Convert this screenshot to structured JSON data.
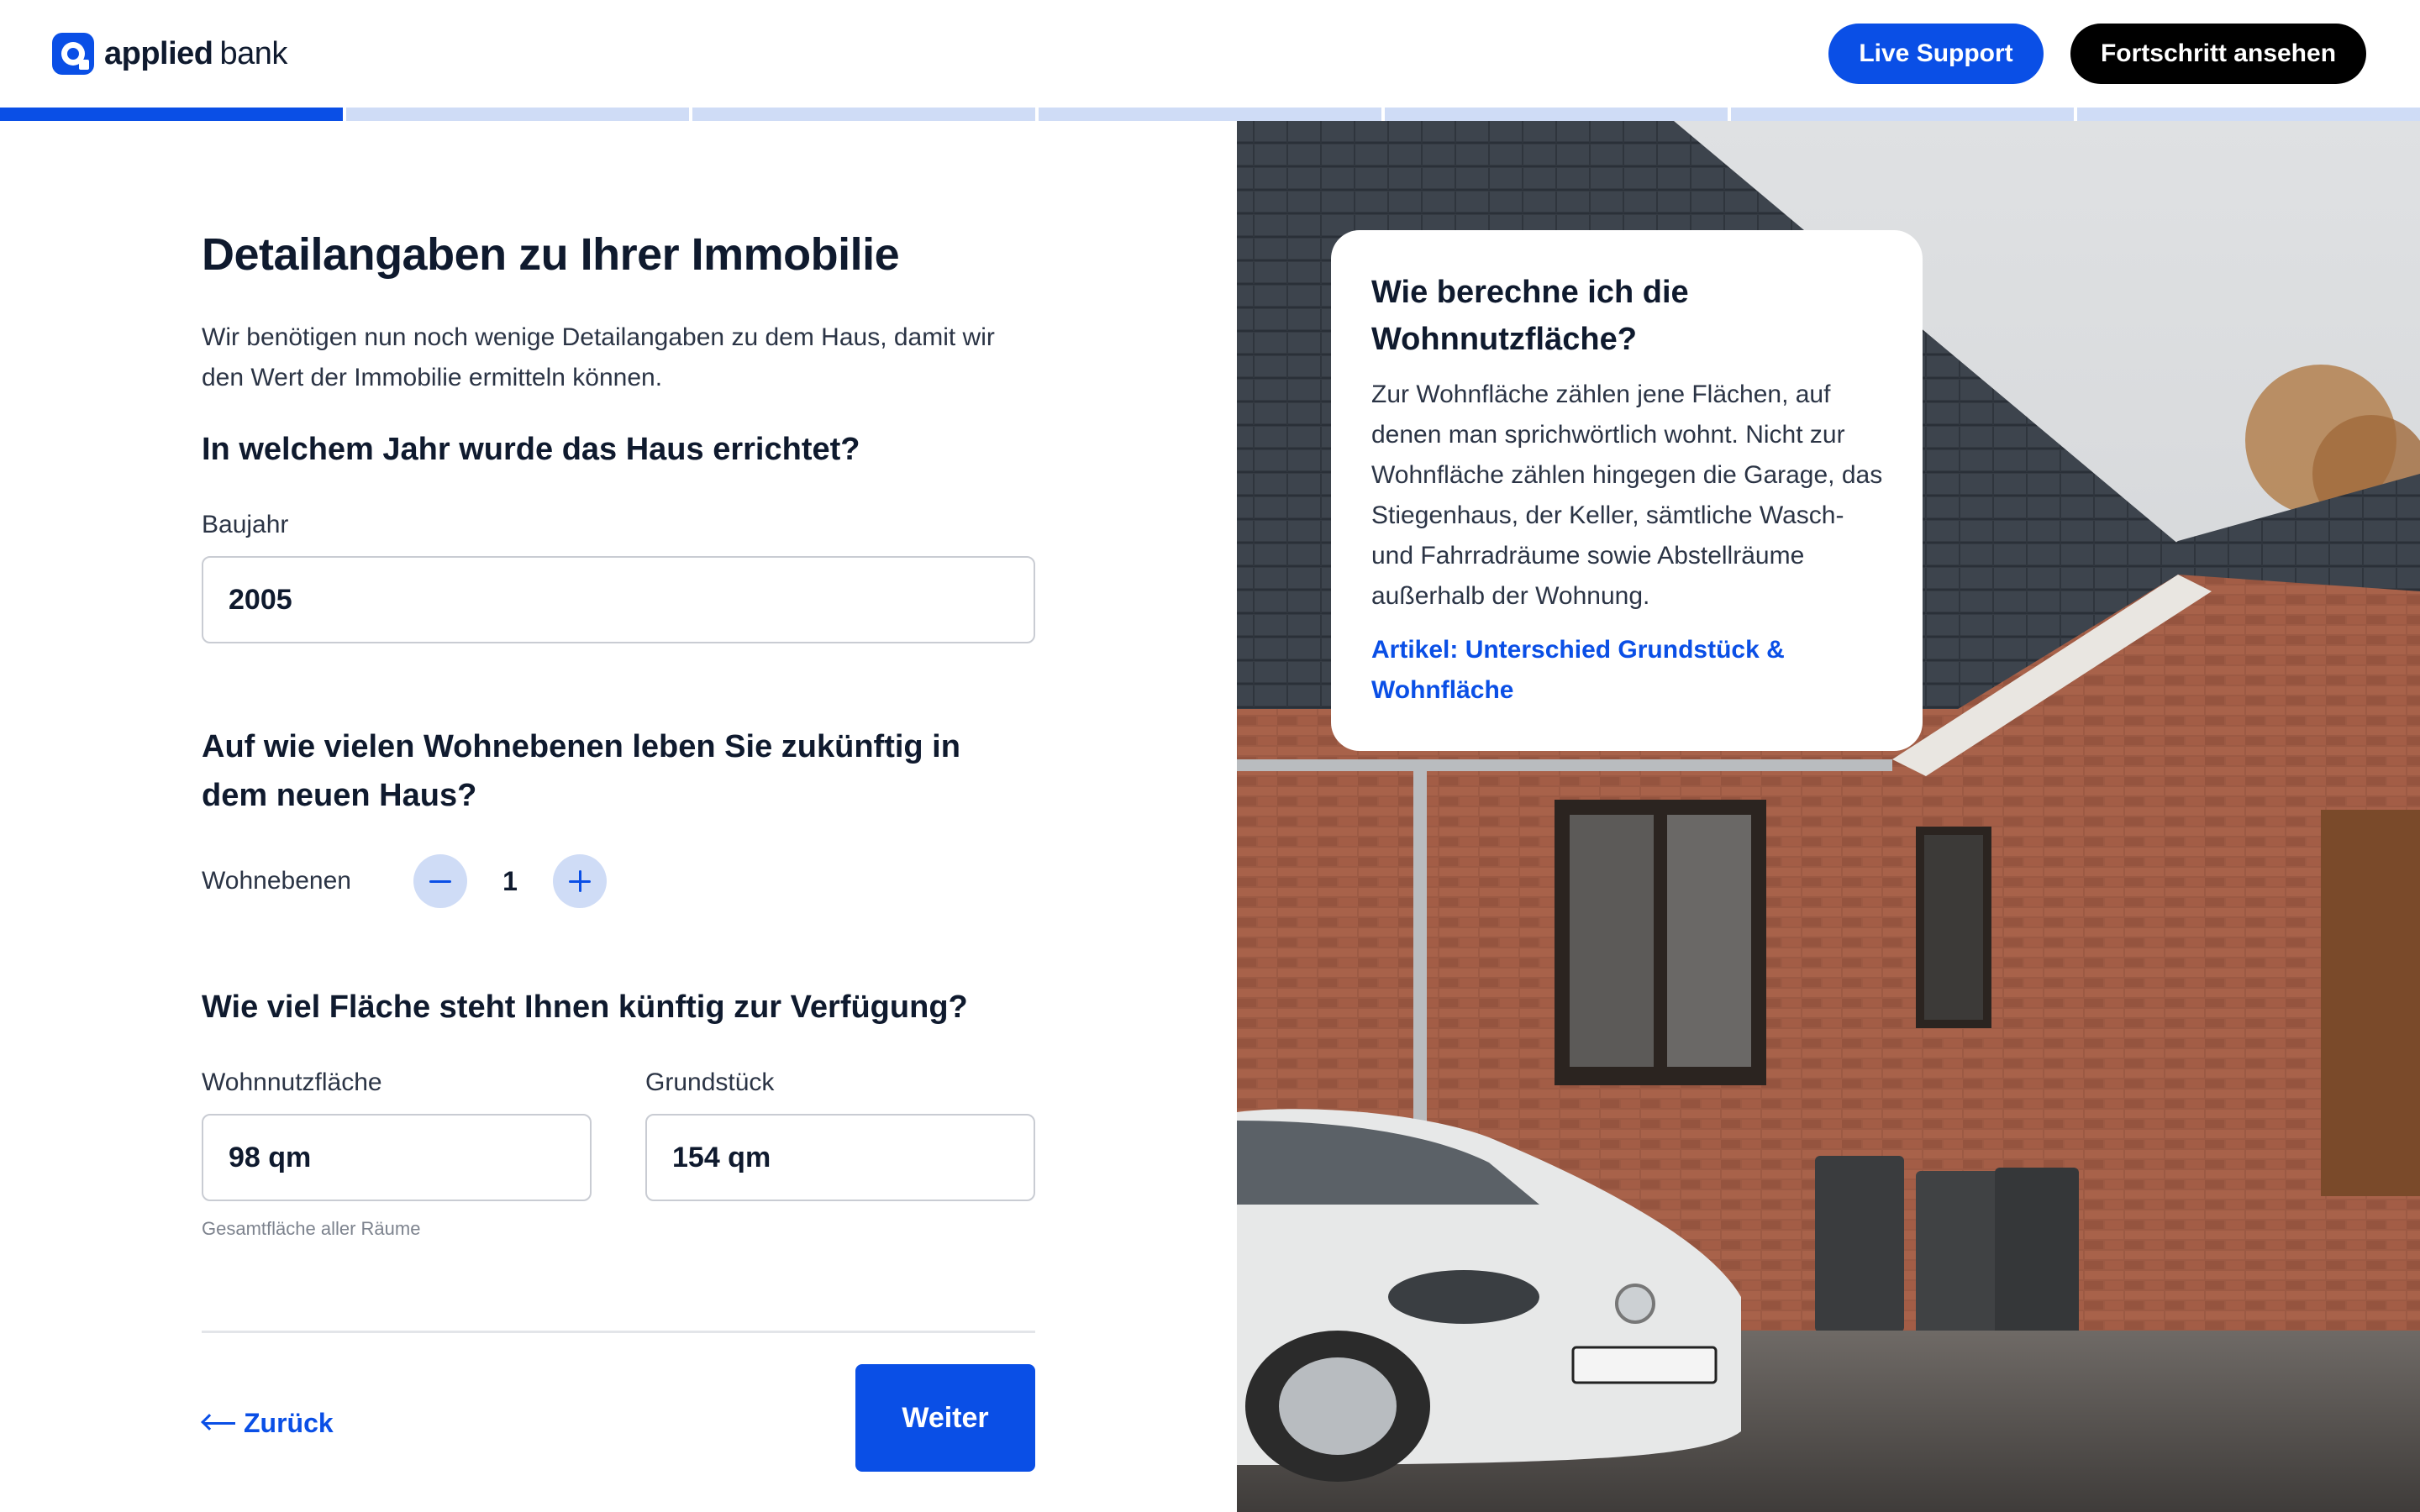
{
  "header": {
    "logo_bold": "applied",
    "logo_regular": "bank",
    "live_support": "Live Support",
    "progress_button": "Fortschritt ansehen"
  },
  "progress": {
    "steps_total": 7,
    "steps_done": 1
  },
  "form": {
    "title": "Detailangaben zu Ihrer Immobilie",
    "intro": "Wir benötigen nun noch wenige Detailangaben zu dem Haus, damit wir den Wert der Immobilie ermitteln können.",
    "q_year": "In welchem Jahr wurde das Haus errichtet?",
    "year_label": "Baujahr",
    "year_value": "2005",
    "q_levels": "Auf wie vielen Wohnebenen leben Sie zukünftig in dem neuen Haus?",
    "levels_label": "Wohnebenen",
    "levels_value": "1",
    "q_area": "Wie viel Fläche steht Ihnen künftig zur Verfügung?",
    "living_label": "Wohnnutzfläche",
    "living_value": "98 qm",
    "living_hint": "Gesamtfläche aller Räume",
    "plot_label": "Grundstück",
    "plot_value": "154 qm",
    "back_label": "Zurück",
    "next_label": "Weiter"
  },
  "info_card": {
    "title": "Wie berechne ich die Wohnnutzfläche?",
    "body": "Zur Wohnfläche zählen jene Flächen, auf denen man sprichwörtlich wohnt.  Nicht zur Wohnfläche zählen hingegen die Garage, das Stiegenhaus, der Keller, sämtliche Wasch- und Fahrradräume sowie Abstellräume außerhalb der Wohnung.",
    "link": "Artikel: Unterschied Grundstück & Wohnfläche"
  },
  "colors": {
    "accent": "#0a4fe6",
    "accent_light": "#cfdcf6",
    "text": "#0f1a2e",
    "border": "#c9ccd3"
  },
  "icons": [
    "logo-mark-icon",
    "minus-icon",
    "plus-icon",
    "arrow-left-icon"
  ]
}
